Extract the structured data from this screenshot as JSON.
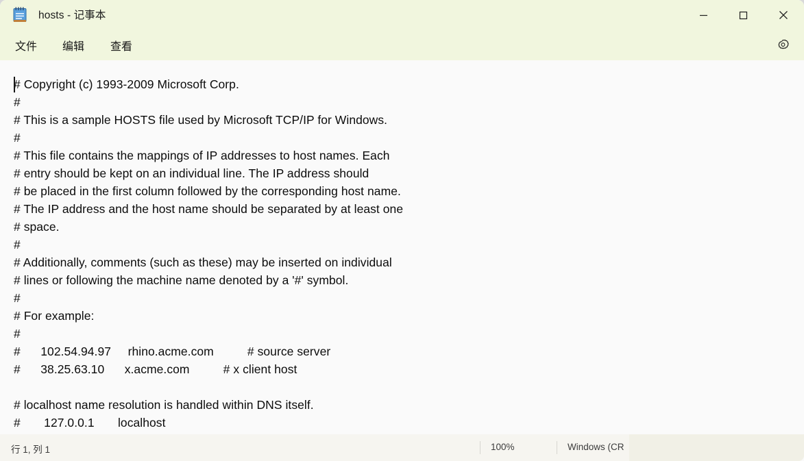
{
  "window": {
    "title": "hosts - 记事本",
    "icon": "notepad-icon",
    "controls": {
      "minimize": "minimize-icon",
      "maximize": "maximize-icon",
      "close": "close-icon"
    },
    "colors": {
      "titlebar_bg": "#f1f6de",
      "editor_bg": "#fafafa",
      "statusbar_bg": "#f6f5f0",
      "text": "#0c0c0c",
      "icon_blue": "#4a8fd4"
    }
  },
  "menubar": {
    "items": [
      {
        "label": "文件",
        "name": "menu-file"
      },
      {
        "label": "编辑",
        "name": "menu-edit"
      },
      {
        "label": "查看",
        "name": "menu-view"
      }
    ],
    "settings_icon": "gear-icon"
  },
  "editor": {
    "content": "# Copyright (c) 1993-2009 Microsoft Corp.\n#\n# This is a sample HOSTS file used by Microsoft TCP/IP for Windows.\n#\n# This file contains the mappings of IP addresses to host names. Each\n# entry should be kept on an individual line. The IP address should\n# be placed in the first column followed by the corresponding host name.\n# The IP address and the host name should be separated by at least one\n# space.\n#\n# Additionally, comments (such as these) may be inserted on individual\n# lines or following the machine name denoted by a '#' symbol.\n#\n# For example:\n#\n#      102.54.94.97     rhino.acme.com          # source server\n#      38.25.63.10      x.acme.com          # x client host\n\n# localhost name resolution is handled within DNS itself.\n#       127.0.0.1       localhost",
    "caret_visible": true
  },
  "statusbar": {
    "position": "行 1, 列 1",
    "zoom": "100%",
    "line_ending": "Windows (CR"
  }
}
